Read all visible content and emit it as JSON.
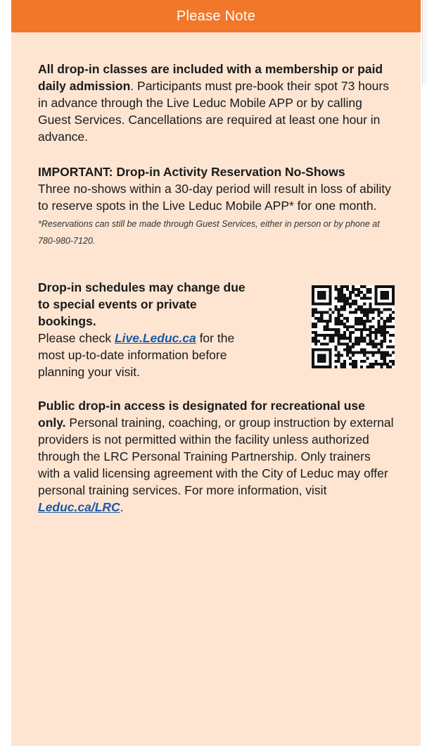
{
  "header": {
    "title": "Please Note"
  },
  "section1": {
    "bold": "All drop-in classes are included with a membership or paid daily admission",
    "text": ". Participants must pre-book their spot 73 hours in advance through the Live Leduc Mobile APP or by calling Guest Services. Cancellations are required at least one hour in advance."
  },
  "section2": {
    "bold": "IMPORTANT: Drop-in Activity Reservation No-Shows",
    "text": "Three no-shows within a 30-day period will result in loss of ability to reserve spots in the Live Leduc Mobile APP* for one month.",
    "note": "*Reservations can still be made through Guest Services, either in person or by phone at 780-980-7120."
  },
  "section3": {
    "bold": "Drop-in schedules may change due to special events or private bookings.",
    "text_before": "Please check ",
    "link": "Live.Leduc.ca",
    "text_after": " for the most up-to-date information before planning your visit."
  },
  "section4": {
    "bold": "Public drop-in access is designated for recreational use only.",
    "text": " Personal training, coaching, or group instruction by external providers is not permitted within the facility unless authorized through the LRC Personal Training Partnership. Only trainers with a valid licensing agreement with the City of Leduc may offer personal training services. For more information, visit ",
    "link": "Leduc.ca/LRC",
    "text_after": "."
  },
  "colors": {
    "header": "#f1772a",
    "panel": "#fde5d2",
    "link": "#1b5aa6"
  },
  "icons": {
    "qr": "qr-code-icon"
  }
}
